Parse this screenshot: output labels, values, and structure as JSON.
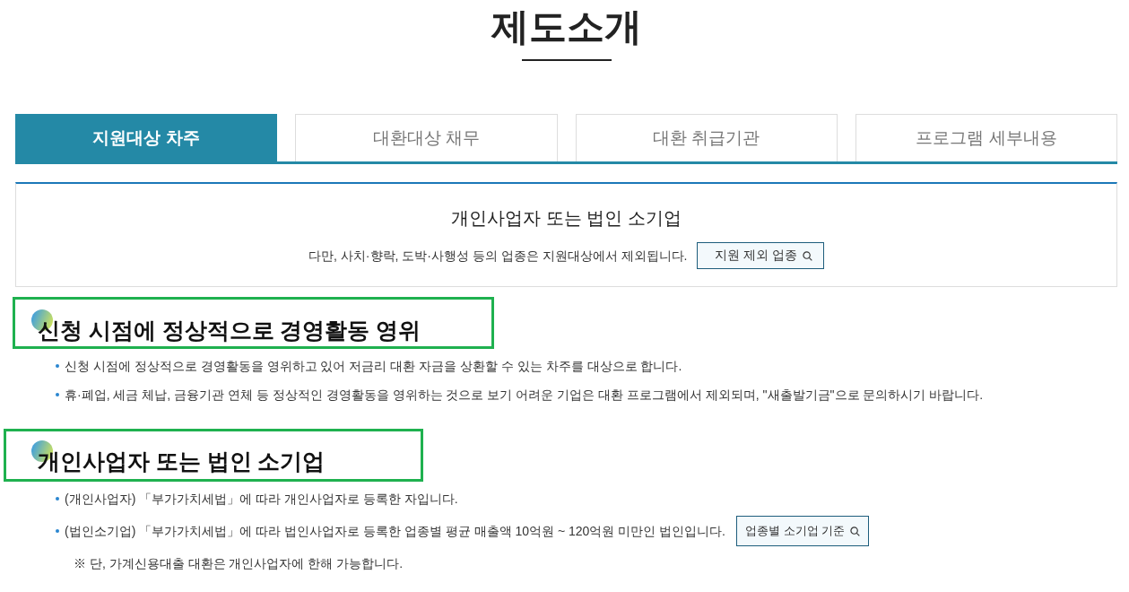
{
  "page_title": "제도소개",
  "tabs": [
    {
      "label": "지원대상 차주",
      "selected": true
    },
    {
      "label": "대환대상 채무",
      "selected": false
    },
    {
      "label": "대환 취급기관",
      "selected": false
    },
    {
      "label": "프로그램 세부내용",
      "selected": false
    }
  ],
  "summary": {
    "heading": "개인사업자 또는 법인 소기업",
    "note": "다만, 사치·향락, 도박·사행성 등의 업종은 지원대상에서 제외됩니다.",
    "button": "지원 제외 업종"
  },
  "sections": [
    {
      "heading": "신청 시점에 정상적으로 경영활동 영위",
      "highlighted": true,
      "items": [
        {
          "kind": "bullet",
          "text": "신청 시점에 정상적으로 경영활동을 영위하고 있어 저금리 대환 자금을 상환할 수 있는 차주를 대상으로 합니다."
        },
        {
          "kind": "bullet",
          "text": "휴·폐업, 세금 체납, 금융기관 연체 등 정상적인 경영활동을 영위하는 것으로 보기 어려운 기업은 대환 프로그램에서 제외되며, \"새출발기금\"으로 문의하시기 바랍니다."
        }
      ]
    },
    {
      "heading": "개인사업자 또는 법인 소기업",
      "highlighted": true,
      "items": [
        {
          "kind": "bullet",
          "text": "(개인사업자) 「부가가치세법」에 따라 개인사업자로 등록한 자입니다."
        },
        {
          "kind": "bullet",
          "text": "(법인소기업) 「부가가치세법」에 따라 법인사업자로 등록한 업종별 평균 매출액 10억원 ~ 120억원 미만인 법인입니다.",
          "button": "업종별 소기업 기준"
        },
        {
          "kind": "note",
          "text": "※ 단, 가계신용대출 대환은 개인사업자에 한해 가능합니다."
        }
      ]
    }
  ]
}
